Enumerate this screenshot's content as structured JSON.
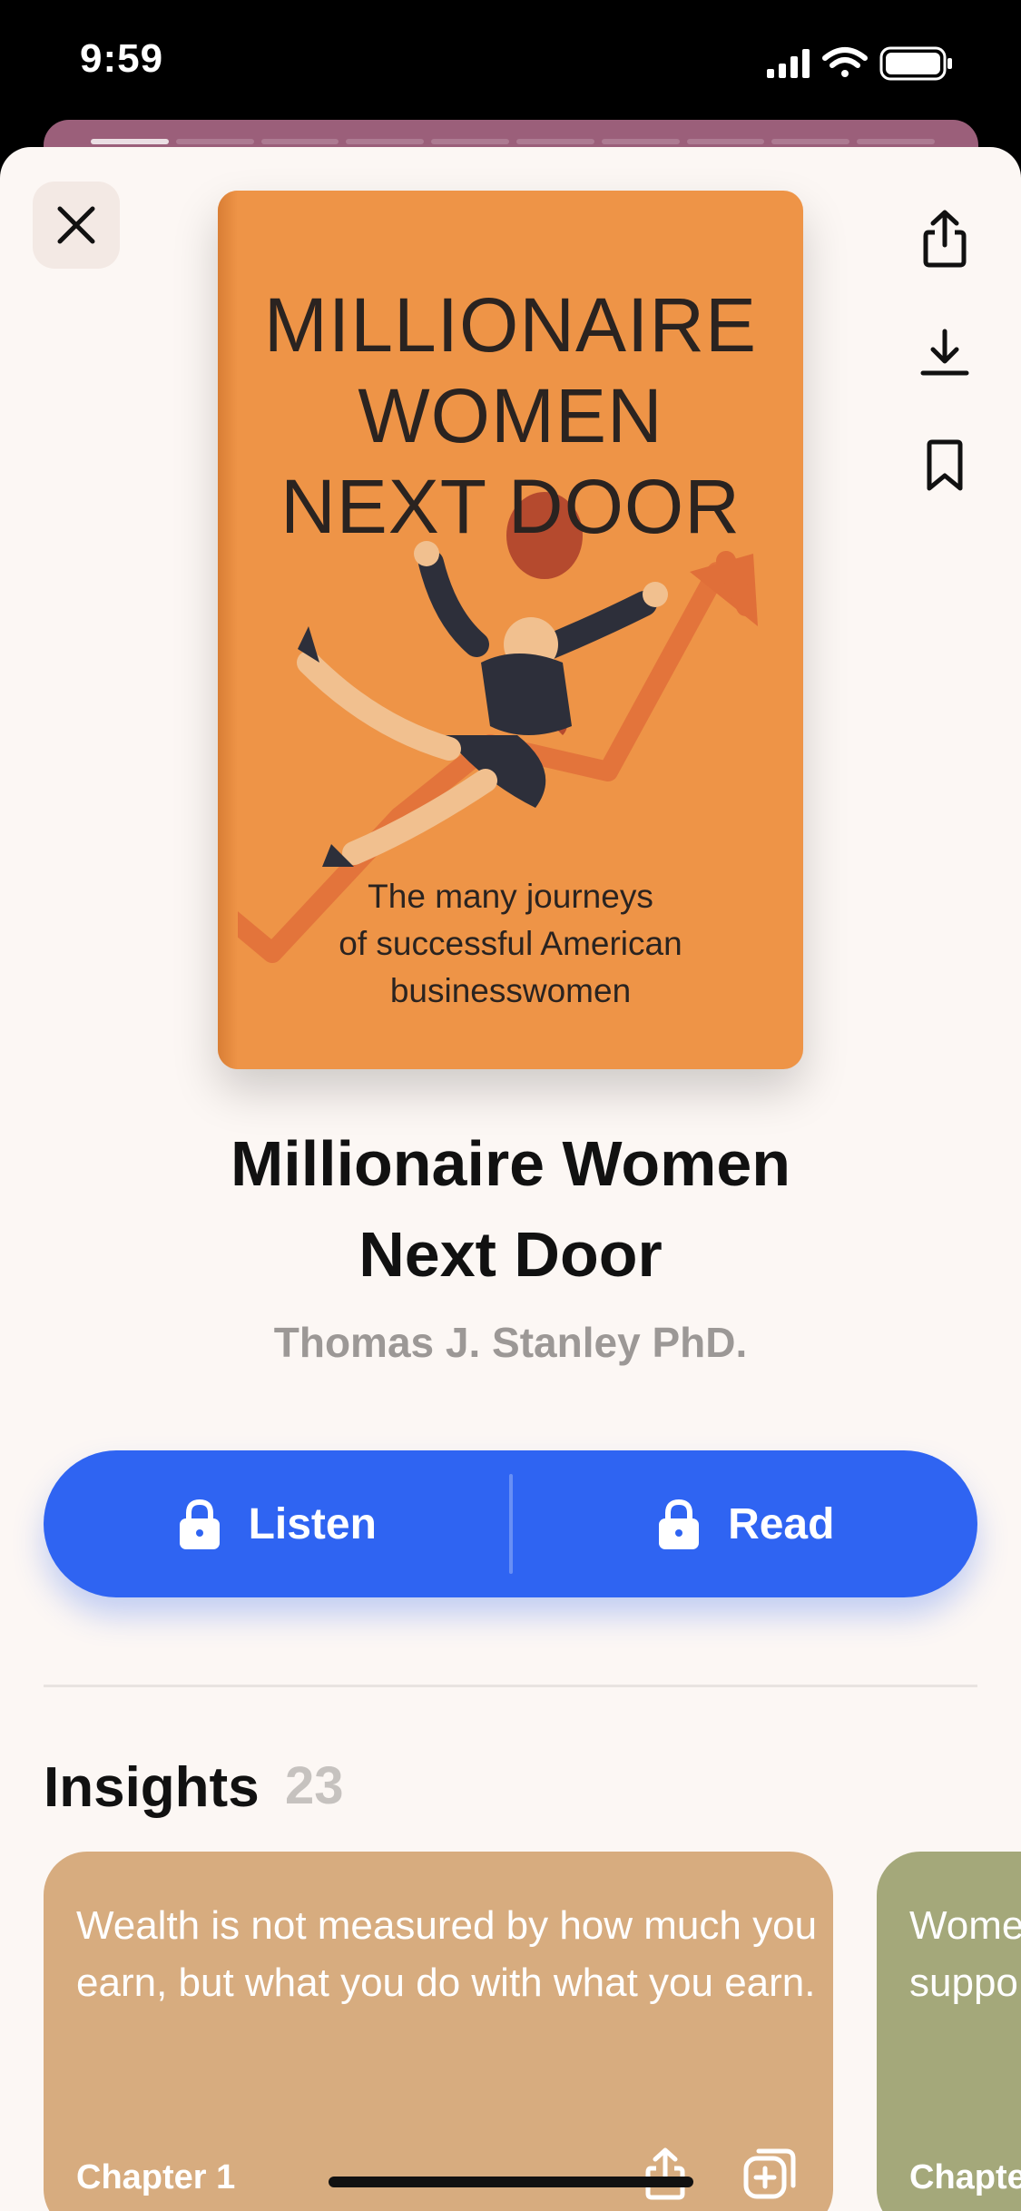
{
  "status_bar": {
    "time": "9:59"
  },
  "story_progress": {
    "segments": 10,
    "active_index": 0
  },
  "book": {
    "cover_title_lines": [
      "MILLIONAIRE",
      "WOMEN",
      "NEXT DOOR"
    ],
    "cover_subtitle_lines": [
      "The many journeys",
      "of successful American",
      "businesswomen"
    ],
    "title_line1": "Millionaire Women",
    "title_line2": "Next Door",
    "author": "Thomas J. Stanley PhD.",
    "cover_color": "#ee9447"
  },
  "actions": {
    "listen_label": "Listen",
    "read_label": "Read",
    "accent": "#2f64f2"
  },
  "insights": {
    "heading": "Insights",
    "count": "23",
    "cards": [
      {
        "text": "Wealth is not measured by how much you earn, but what you do with what you earn.",
        "chapter": "Chapter 1",
        "color": "#d7ac7f"
      },
      {
        "text": "Wome harde suppo",
        "chapter": "Chapte",
        "color": "#a4a87a"
      }
    ]
  },
  "icons": {
    "close": "close-icon",
    "share": "share-icon",
    "download": "download-icon",
    "bookmark": "bookmark-icon",
    "lock": "lock-icon",
    "add_collection": "add-to-collection-icon"
  }
}
